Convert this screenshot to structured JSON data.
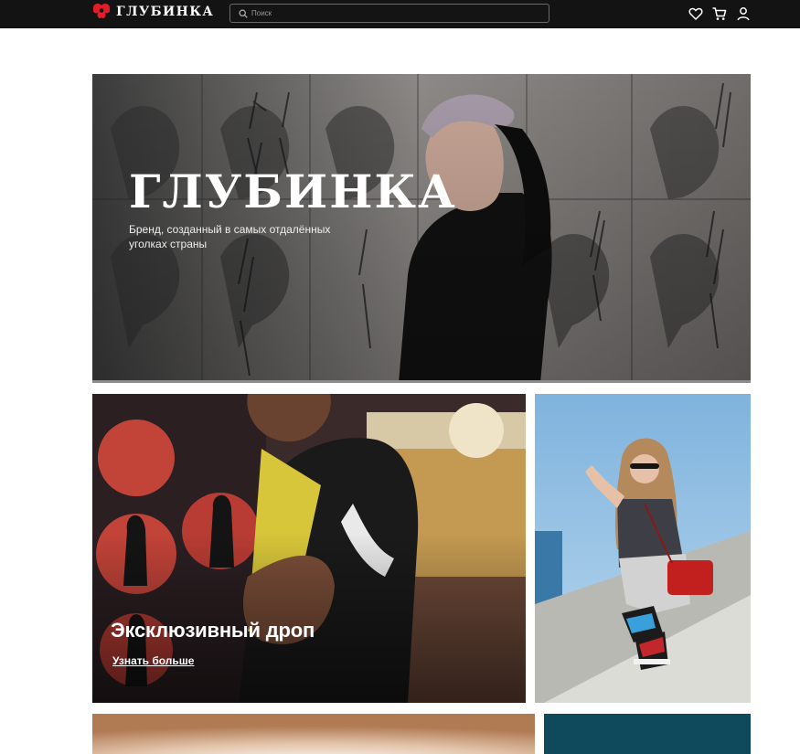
{
  "header": {
    "brand": "ГЛУБИНКА",
    "search_placeholder": "Поиск",
    "icons": [
      "logo-mark-icon",
      "search-icon",
      "heart-icon",
      "cart-icon",
      "user-icon"
    ]
  },
  "hero": {
    "title": "ГЛУБИНКА",
    "subtitle": "Бренд, созданный в самых отдалённых уголках страны"
  },
  "drop": {
    "title": "Эксклюзивный дроп",
    "link": "Узнать больше"
  },
  "colors": {
    "header_bg": "#131313",
    "logo_red": "#e11d25",
    "text_on_photo": "#ffffff",
    "bottom_right_tile": "#0e4a5b"
  }
}
